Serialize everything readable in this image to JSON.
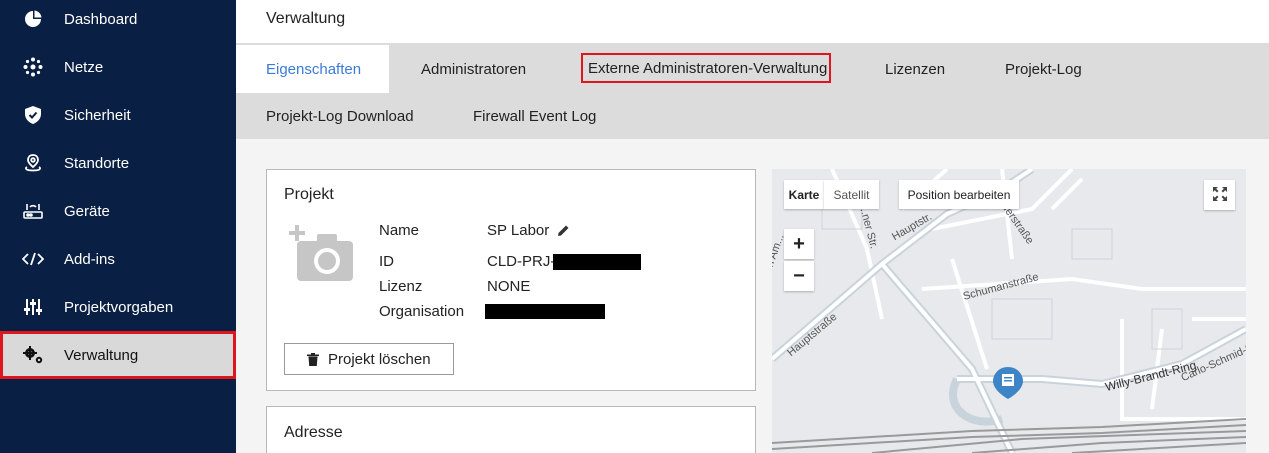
{
  "sidebar": {
    "items": [
      {
        "label": "Dashboard",
        "icon": "dashboard-icon"
      },
      {
        "label": "Netze",
        "icon": "network-icon"
      },
      {
        "label": "Sicherheit",
        "icon": "shield-icon"
      },
      {
        "label": "Standorte",
        "icon": "location-pin-icon"
      },
      {
        "label": "Geräte",
        "icon": "router-icon"
      },
      {
        "label": "Add-ins",
        "icon": "code-icon"
      },
      {
        "label": "Projektvorgaben",
        "icon": "sliders-icon"
      },
      {
        "label": "Verwaltung",
        "icon": "gears-icon"
      }
    ],
    "active_item": "Verwaltung"
  },
  "header": {
    "title": "Verwaltung"
  },
  "tabs": [
    {
      "label": "Eigenschaften",
      "active": true
    },
    {
      "label": "Administratoren"
    },
    {
      "label": "Externe Administratoren-Verwaltung",
      "highlighted": true
    },
    {
      "label": "Lizenzen"
    },
    {
      "label": "Projekt-Log"
    },
    {
      "label": "Projekt-Log Download"
    },
    {
      "label": "Firewall Event Log"
    }
  ],
  "project_card": {
    "title": "Projekt",
    "fields": {
      "name_label": "Name",
      "name_value": "SP Labor",
      "id_label": "ID",
      "id_value": "CLD-PRJ-",
      "license_label": "Lizenz",
      "license_value": "NONE",
      "organisation_label": "Organisation"
    },
    "delete_button": "Projekt löschen"
  },
  "address_card": {
    "title": "Adresse"
  },
  "map": {
    "type_buttons": [
      "Karte",
      "Satellit"
    ],
    "selected_type": "Karte",
    "edit_position_button": "Position bearbeiten",
    "zoom_in": "+",
    "zoom_out": "−",
    "street_labels": [
      "Hauptstraße",
      "Hauptstr.",
      "...ner Str.",
      "...hauerstraße",
      "Schumanstraße",
      "Willy-Brandt-Ring",
      "Carlo-Schmid-S...",
      "...n Am..."
    ],
    "colors": {
      "marker": "#3d85c6",
      "roads": "#ffffff",
      "rail": "#9a9a9a"
    }
  },
  "colors": {
    "sidebar_bg": "#0a1f44",
    "active_tab_text": "#3b7bd8",
    "highlight_outline": "#e0161e"
  }
}
